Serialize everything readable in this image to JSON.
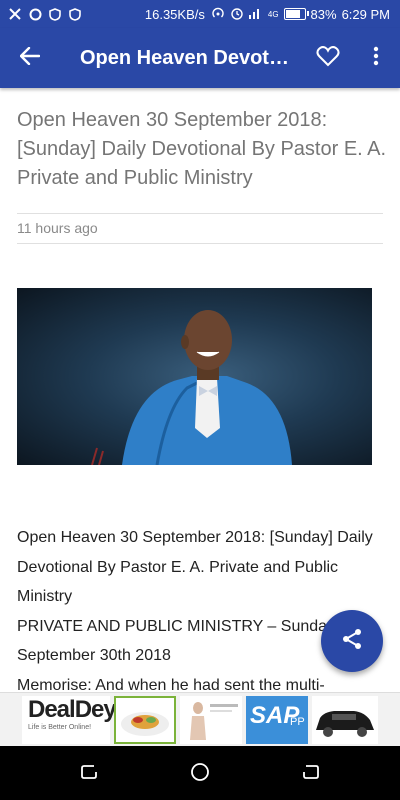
{
  "status_bar": {
    "speed": "16.35KB/s",
    "network": "4G",
    "battery_percent": "83%",
    "battery_level": 0.83,
    "time": "6:29 PM"
  },
  "app_bar": {
    "title": "Open Heaven Devot…"
  },
  "article": {
    "headline": "Open Heaven 30 September 2018: [Sunday] Daily Devotional By Pastor E. A. Private and Public Ministry",
    "time_ago": "11 hours ago",
    "paragraphs": [
      "Open Heaven 30 September 2018: [Sunday] Daily Devotional By Pastor E. A. Private and Public Ministry",
      "PRIVATE AND PUBLIC MINISTRY – Sunday September 30th 2018",
      "Memorise: And when he had sent the multi-"
    ]
  },
  "ads": {
    "dealdey_name": "DealDey",
    "dealdey_tagline": "Life is Better Online!",
    "sap_label": "SAP",
    "sap_sub": "PP"
  },
  "colors": {
    "primary": "#2a48a6",
    "dealdey_green": "#7bb33a"
  },
  "icons": [
    "back-arrow-icon",
    "heart-icon",
    "more-vert-icon",
    "share-icon",
    "recents-icon",
    "home-icon",
    "back-nav-icon"
  ]
}
